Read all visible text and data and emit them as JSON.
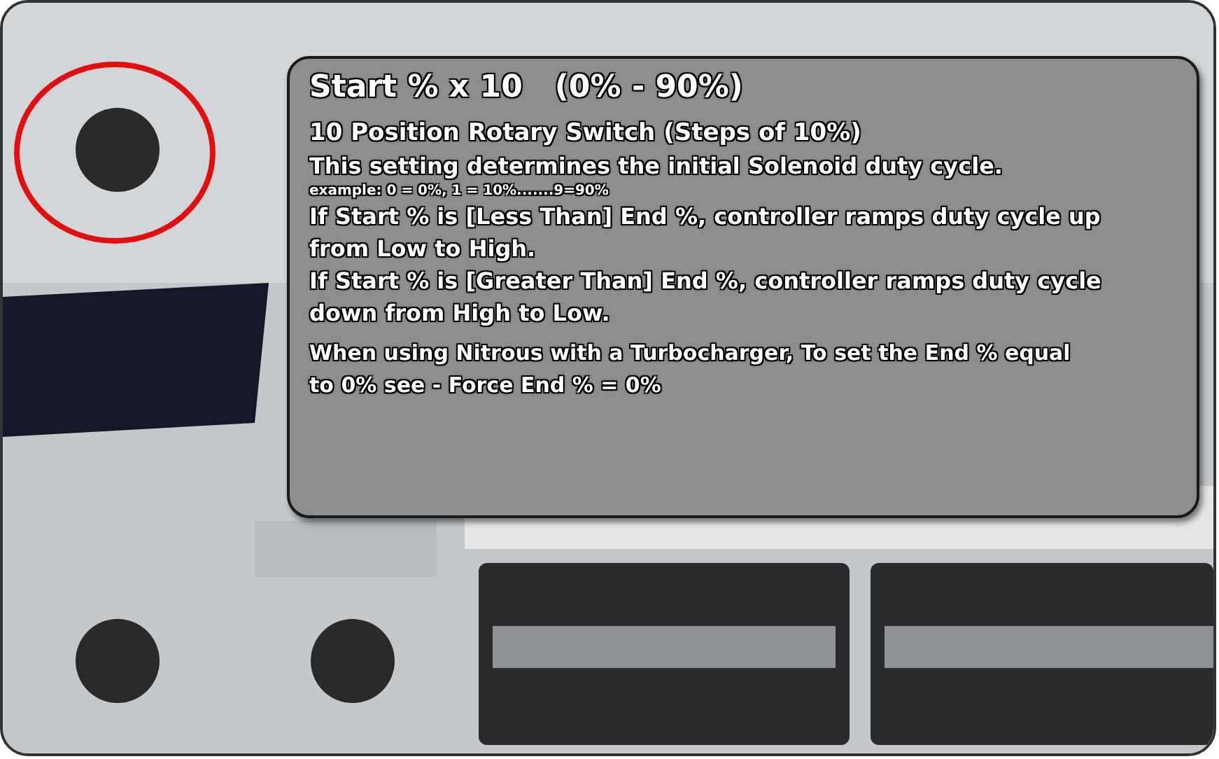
{
  "tooltip": {
    "title": "Start % x 10   (0% - 90%)",
    "subtitle": "10 Position Rotary Switch (Steps of 10%)",
    "paragraphs": [
      {
        "kind": "normal",
        "text": "This setting determines the initial Solenoid duty cycle."
      },
      {
        "kind": "small",
        "text": "example: 0 = 0%, 1 = 10%.......9=90%"
      },
      {
        "kind": "normal",
        "text": "If Start % is [Less Than] End %, controller ramps duty cycle up from Low to High."
      },
      {
        "kind": "normal",
        "text": "If Start % is [Greater Than] End %, controller ramps duty cycle down from High to Low."
      },
      {
        "kind": "note",
        "text": "When using Nitrous with a Turbocharger, To set the End % equal to 0% see - Force End % = 0%"
      }
    ]
  }
}
